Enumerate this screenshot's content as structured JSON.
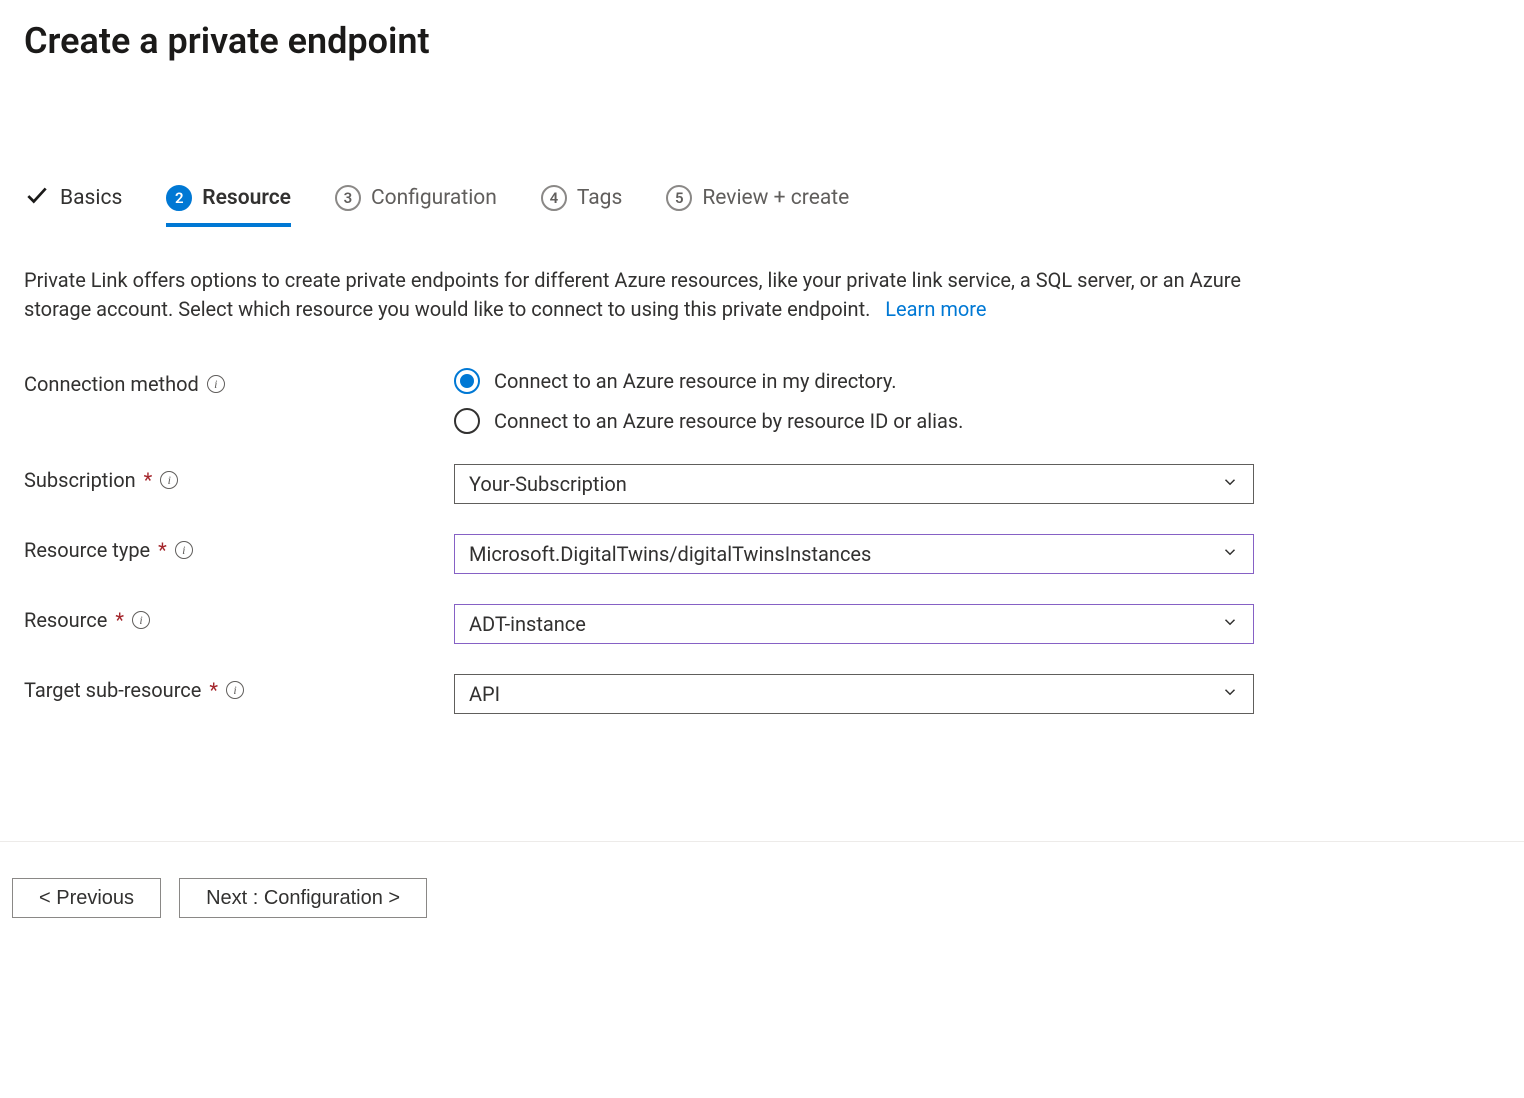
{
  "page": {
    "title": "Create a private endpoint"
  },
  "tabs": {
    "basics": "Basics",
    "resource": "Resource",
    "configuration": "Configuration",
    "tags": "Tags",
    "review": "Review + create",
    "steps": {
      "resource": "2",
      "configuration": "3",
      "tags": "4",
      "review": "5"
    }
  },
  "description": {
    "text": "Private Link offers options to create private endpoints for different Azure resources, like your private link service, a SQL server, or an Azure storage account. Select which resource you would like to connect to using this private endpoint.",
    "link": "Learn more"
  },
  "labels": {
    "connection_method": "Connection method",
    "subscription": "Subscription",
    "resource_type": "Resource type",
    "resource": "Resource",
    "target_sub_resource": "Target sub-resource"
  },
  "radios": {
    "in_directory": "Connect to an Azure resource in my directory.",
    "by_id": "Connect to an Azure resource by resource ID or alias."
  },
  "values": {
    "subscription": "Your-Subscription",
    "resource_type": "Microsoft.DigitalTwins/digitalTwinsInstances",
    "resource": "ADT-instance",
    "target_sub_resource": "API"
  },
  "buttons": {
    "previous": "< Previous",
    "next": "Next : Configuration >"
  }
}
